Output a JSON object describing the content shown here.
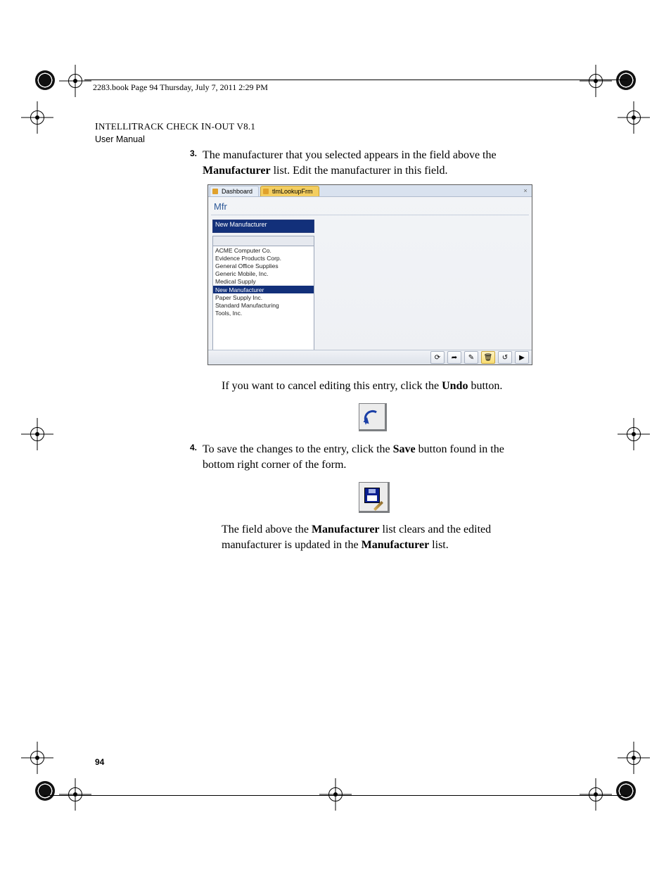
{
  "running_header": "2283.book  Page 94  Thursday, July 7, 2011  2:29 PM",
  "doc_title": "IntelliTrack Check In-Out v8.1",
  "doc_sub": "User Manual",
  "step3": {
    "num": "3.",
    "pre": "The manufacturer that you selected appears in the field above the ",
    "b1": "Manufacturer",
    "post": " list. Edit the manufacturer in this field."
  },
  "screenshot": {
    "tabs": {
      "dashboard": "Dashboard",
      "active": "tlmLookupFrm"
    },
    "close_glyph": "×",
    "heading": "Mfr",
    "edit_value": "New Manufacturer",
    "list": [
      "ACME Computer Co.",
      "Evidence Products Corp.",
      "General Office Supplies",
      "Generic Mobile, Inc.",
      "Medical Supply",
      "New Manufacturer",
      "Paper Supply Inc.",
      "Standard Manufacturing",
      "Tools, Inc."
    ],
    "selected_index": 5,
    "toolbar_glyphs": [
      "⟳",
      "➦",
      "✎",
      "🗑",
      "↺",
      "▶"
    ]
  },
  "undo_para": {
    "pre": "If you want to cancel editing this entry, click the ",
    "b": "Undo",
    "post": " button."
  },
  "step4": {
    "num": "4.",
    "pre": "To save the changes to the entry, click the ",
    "b": "Save",
    "post": " button found in the bottom right corner of the form."
  },
  "final_para": {
    "t1": "The field above the ",
    "b1": "Manufacturer",
    "t2": " list clears and the edited manufacturer is updated in the ",
    "b2": "Manufacturer",
    "t3": " list."
  },
  "page_no": "94"
}
